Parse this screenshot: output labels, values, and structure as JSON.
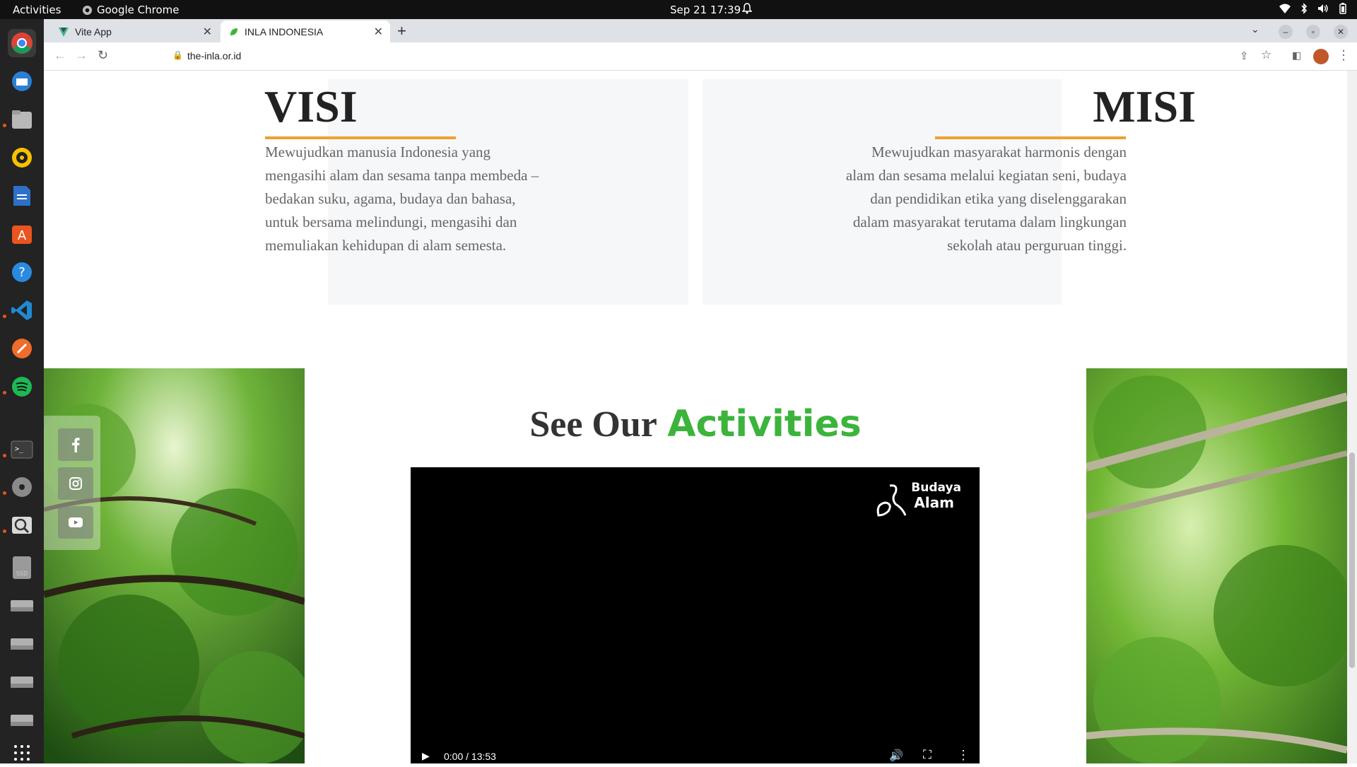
{
  "system_bar": {
    "activities": "Activities",
    "app_name": "Google Chrome",
    "datetime": "Sep 21  17:39",
    "icons": [
      "chrome-icon",
      "bell-icon",
      "wifi-icon",
      "bluetooth-icon",
      "volume-icon",
      "battery-icon"
    ]
  },
  "dock": {
    "items": [
      "chrome-icon",
      "thunderbird-icon",
      "files-icon",
      "rhythmbox-icon",
      "writer-icon",
      "software-icon",
      "help-icon",
      "vscode-icon",
      "postman-icon",
      "spotify-icon",
      "terminal-icon",
      "disc-icon",
      "magnifier-icon",
      "ssd-icon",
      "drive-icon",
      "drive-icon",
      "drive-icon",
      "drive-icon",
      "app-grid-icon"
    ],
    "ssd_label": "SSD"
  },
  "browser": {
    "tabs": [
      {
        "title": "Vite App",
        "active": false
      },
      {
        "title": "INLA INDONESIA",
        "active": true
      }
    ],
    "url": "the-inla.or.id"
  },
  "page": {
    "visi": {
      "title": "VISI",
      "lines": [
        "Mewujudkan manusia Indonesia yang",
        "mengasihi alam dan sesama tanpa membeda –",
        "bedakan suku, agama, budaya dan bahasa,",
        "untuk bersama melindungi, mengasihi dan",
        "memuliakan kehidupan di alam semesta."
      ]
    },
    "misi": {
      "title": "MISI",
      "lines": [
        "Mewujudkan masyarakat harmonis dengan",
        "alam dan sesama melalui kegiatan seni, budaya",
        "dan pendidikan etika yang diselenggarakan",
        "dalam masyarakat terutama dalam lingkungan",
        "sekolah atau perguruan tinggi."
      ]
    },
    "activities": {
      "title_part1": "See Our",
      "title_part2": "Activities",
      "accent_color": "#3cb43c"
    },
    "video": {
      "logo_line1": "Budaya",
      "logo_line2": "Alam",
      "time": "0:00 / 13:53"
    },
    "social": [
      "facebook-icon",
      "instagram-icon",
      "youtube-icon"
    ]
  }
}
